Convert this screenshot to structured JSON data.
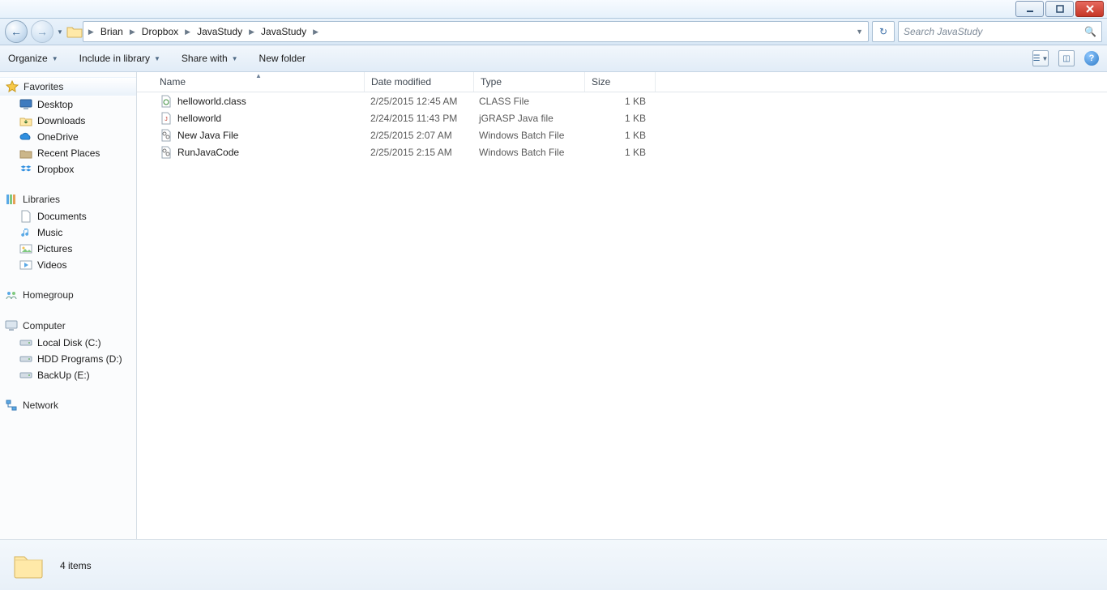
{
  "breadcrumbs": [
    "Brian",
    "Dropbox",
    "JavaStudy",
    "JavaStudy"
  ],
  "search_placeholder": "Search JavaStudy",
  "toolbar": {
    "organize": "Organize",
    "include": "Include in library",
    "share": "Share with",
    "newfolder": "New folder"
  },
  "columns": {
    "name": "Name",
    "date": "Date modified",
    "type": "Type",
    "size": "Size"
  },
  "nav": {
    "favorites": "Favorites",
    "fav_items": [
      "Desktop",
      "Downloads",
      "OneDrive",
      "Recent Places",
      "Dropbox"
    ],
    "libraries": "Libraries",
    "lib_items": [
      "Documents",
      "Music",
      "Pictures",
      "Videos"
    ],
    "homegroup": "Homegroup",
    "computer": "Computer",
    "comp_items": [
      "Local Disk (C:)",
      "HDD Programs (D:)",
      "BackUp (E:)"
    ],
    "network": "Network"
  },
  "files": [
    {
      "name": "helloworld.class",
      "date": "2/25/2015 12:45 AM",
      "type": "CLASS File",
      "size": "1 KB",
      "icon": "class"
    },
    {
      "name": "helloworld",
      "date": "2/24/2015 11:43 PM",
      "type": "jGRASP Java file",
      "size": "1 KB",
      "icon": "java"
    },
    {
      "name": "New Java File",
      "date": "2/25/2015 2:07 AM",
      "type": "Windows Batch File",
      "size": "1 KB",
      "icon": "batch"
    },
    {
      "name": "RunJavaCode",
      "date": "2/25/2015 2:15 AM",
      "type": "Windows Batch File",
      "size": "1 KB",
      "icon": "batch"
    }
  ],
  "status": "4 items"
}
